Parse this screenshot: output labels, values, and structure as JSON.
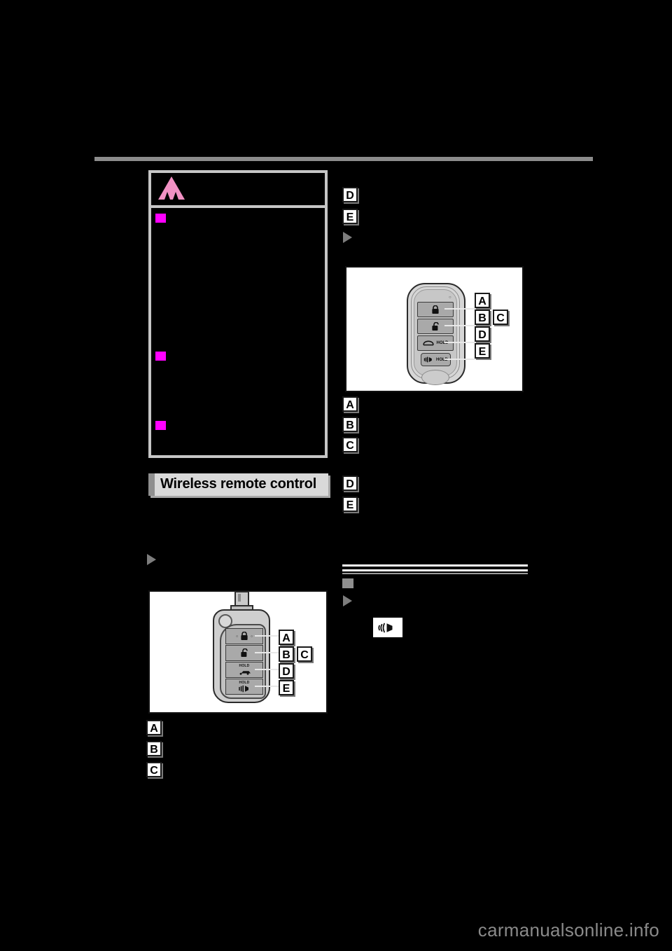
{
  "page": {
    "background_color": "#000000",
    "watermark": "carmanualsonline.info"
  },
  "warning_box": {
    "icon": "warning-triangle-icon",
    "icon_color": "#F291C4",
    "bullet_color": "#FF00FF",
    "bullet_count": 3,
    "border_color": "#C6C6C6"
  },
  "section_heading": {
    "label": "Wireless remote control",
    "accent_bar_color": "#8F8F8F",
    "background_color": "#D9D9D9"
  },
  "left_column": {
    "figure": {
      "name": "wireless-remote-control-key",
      "callouts": [
        {
          "letter": "A",
          "button": "lock-button"
        },
        {
          "letter": "B",
          "button": "unlock-button"
        },
        {
          "letter": "C",
          "button": "lock-unlock-group"
        },
        {
          "letter": "D",
          "button": "trunk-release-button",
          "hold_label": "HOLD"
        },
        {
          "letter": "E",
          "button": "panic-alarm-button",
          "hold_label": "HOLD"
        }
      ]
    },
    "callout_list": [
      "A",
      "B",
      "C"
    ]
  },
  "right_column": {
    "top_callout_list": [
      "D",
      "E"
    ],
    "figure": {
      "name": "electronic-smart-key",
      "callouts": [
        {
          "letter": "A",
          "button": "lock-button"
        },
        {
          "letter": "B",
          "button": "unlock-button"
        },
        {
          "letter": "C",
          "button": "lock-unlock-group"
        },
        {
          "letter": "D",
          "button": "trunk-release-button",
          "hold_label": "HOLD"
        },
        {
          "letter": "E",
          "button": "panic-alarm-button",
          "hold_label": "HOLD"
        }
      ]
    },
    "callout_list": [
      "A",
      "B",
      "C",
      "D",
      "E"
    ],
    "sub_section": {
      "bullet_color": "#8F8F8F",
      "icon": "alarm-speaker-icon"
    }
  },
  "hold_label": "HOLD"
}
